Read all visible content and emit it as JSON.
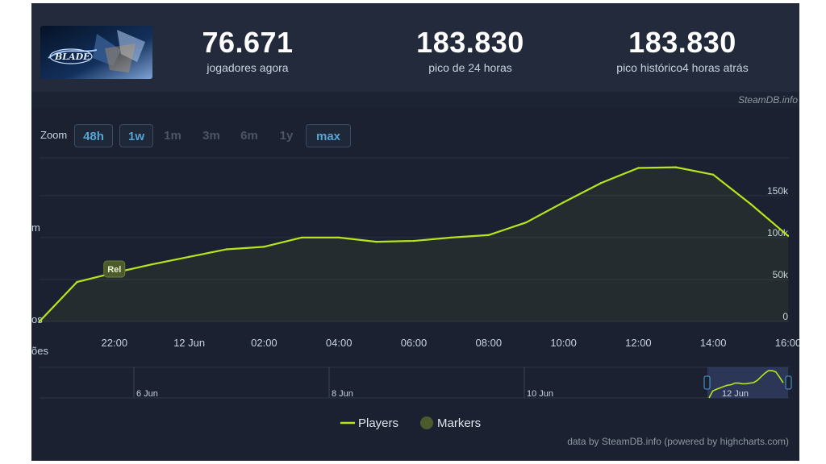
{
  "stats": [
    {
      "value": "76.671",
      "label": "jogadores agora"
    },
    {
      "value": "183.830",
      "label": "pico de 24 horas"
    },
    {
      "value": "183.830",
      "label": "pico histórico4 horas atrás"
    }
  ],
  "credit_top": "SteamDB.info",
  "credit_bottom": "data by SteamDB.info (powered by highcharts.com)",
  "zoom": {
    "label": "Zoom",
    "buttons": [
      {
        "label": "48h",
        "active": true
      },
      {
        "label": "1w",
        "active": true
      },
      {
        "label": "1m",
        "active": false
      },
      {
        "label": "3m",
        "active": false
      },
      {
        "label": "6m",
        "active": false
      },
      {
        "label": "1y",
        "active": false
      },
      {
        "label": "max",
        "active": true
      }
    ]
  },
  "colors": {
    "series": "#b7e51b",
    "marker": "#4c5a2c",
    "grid": "#2b3444",
    "axis_text": "#c6d4df"
  },
  "cut_off_labels": {
    "left_axis_mid": "m",
    "left_axis_low": "os",
    "left_axis_bottom": "ões"
  },
  "legend": [
    {
      "name": "Players",
      "icon": "line"
    },
    {
      "name": "Markers",
      "icon": "circle"
    }
  ],
  "chart_data": {
    "type": "area",
    "x": [
      "20:00",
      "21:00",
      "22:00",
      "23:00",
      "12 Jun",
      "01:00",
      "02:00",
      "03:00",
      "04:00",
      "05:00",
      "06:00",
      "07:00",
      "08:00",
      "09:00",
      "10:00",
      "11:00",
      "12:00",
      "13:00",
      "14:00",
      "15:00",
      "16:00",
      "16:45"
    ],
    "x_tick_labels": [
      "22:00",
      "12 Jun",
      "02:00",
      "04:00",
      "06:00",
      "08:00",
      "10:00",
      "12:00",
      "14:00",
      "16:00"
    ],
    "y_tick_labels": [
      "0",
      "50k",
      "100k",
      "150k"
    ],
    "ylim": [
      0,
      195000
    ],
    "series": [
      {
        "name": "Players",
        "values": [
          0,
          47000,
          58000,
          68000,
          77000,
          86000,
          89000,
          100000,
          100000,
          95000,
          96000,
          100000,
          103000,
          118000,
          142000,
          165000,
          183000,
          183830,
          175000,
          140000,
          102000
        ]
      }
    ],
    "markers": [
      {
        "x": "22:00",
        "label": "Rel"
      }
    ],
    "navigator": {
      "tick_labels": [
        "6 Jun",
        "8 Jun",
        "10 Jun",
        "12 Jun"
      ]
    },
    "grid": true,
    "legend_position": "bottom-center"
  }
}
